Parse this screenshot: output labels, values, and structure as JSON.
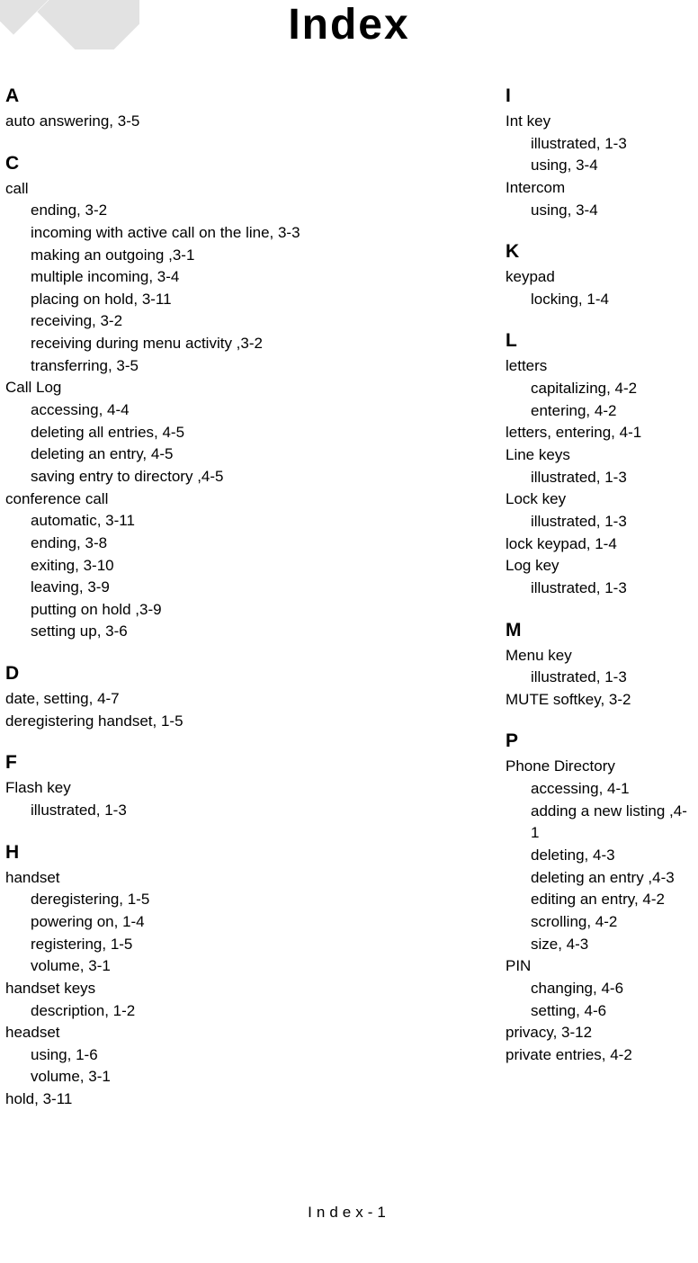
{
  "title": "Index",
  "footer": "Index-1",
  "left": [
    {
      "letter": "A",
      "first": true,
      "groups": [
        {
          "main": "auto answering, 3-5"
        }
      ]
    },
    {
      "letter": "C",
      "groups": [
        {
          "main": "call",
          "subs": [
            "ending, 3-2",
            "incoming with active call on the line, 3-3",
            "making an outgoing ,3-1",
            "multiple incoming, 3-4",
            "placing on hold, 3-11",
            "receiving, 3-2",
            "receiving during menu activity ,3-2",
            "transferring, 3-5"
          ]
        },
        {
          "main": "Call Log",
          "subs": [
            "accessing, 4-4",
            "deleting all entries, 4-5",
            "deleting an entry, 4-5",
            "saving entry to directory ,4-5"
          ]
        },
        {
          "main": "conference call",
          "subs": [
            "automatic, 3-11",
            "ending, 3-8",
            "exiting, 3-10",
            "leaving, 3-9",
            "putting on hold ,3-9",
            "setting up, 3-6"
          ]
        }
      ]
    },
    {
      "letter": "D",
      "groups": [
        {
          "main": "date, setting, 4-7"
        },
        {
          "main": "deregistering handset, 1-5"
        }
      ]
    },
    {
      "letter": "F",
      "groups": [
        {
          "main": "Flash key",
          "subs": [
            "illustrated, 1-3"
          ]
        }
      ]
    },
    {
      "letter": "H",
      "groups": [
        {
          "main": "handset",
          "subs": [
            "deregistering, 1-5",
            "powering on, 1-4",
            "registering, 1-5",
            "volume, 3-1"
          ]
        },
        {
          "main": "handset keys",
          "subs": [
            "description, 1-2"
          ]
        },
        {
          "main": "headset",
          "subs": [
            "using, 1-6",
            "volume, 3-1"
          ]
        },
        {
          "main": "hold, 3-11"
        }
      ]
    }
  ],
  "right": [
    {
      "letter": "I",
      "first": true,
      "groups": [
        {
          "main": "Int key",
          "subs": [
            "illustrated, 1-3",
            "using, 3-4"
          ]
        },
        {
          "main": "Intercom",
          "subs": [
            "using, 3-4"
          ]
        }
      ]
    },
    {
      "letter": "K",
      "groups": [
        {
          "main": "keypad",
          "subs": [
            "locking, 1-4"
          ]
        }
      ]
    },
    {
      "letter": "L",
      "groups": [
        {
          "main": "letters",
          "subs": [
            "capitalizing, 4-2",
            "entering, 4-2"
          ]
        },
        {
          "main": "letters, entering, 4-1"
        },
        {
          "main": "Line keys",
          "subs": [
            "illustrated, 1-3"
          ]
        },
        {
          "main": "Lock key",
          "subs": [
            "illustrated, 1-3"
          ]
        },
        {
          "main": "lock keypad, 1-4"
        },
        {
          "main": "Log key",
          "subs": [
            "illustrated, 1-3"
          ]
        }
      ]
    },
    {
      "letter": "M",
      "groups": [
        {
          "main": "Menu key",
          "subs": [
            "illustrated, 1-3"
          ]
        },
        {
          "main": "MUTE softkey, 3-2"
        }
      ]
    },
    {
      "letter": "P",
      "groups": [
        {
          "main": "Phone Directory",
          "subs": [
            "accessing, 4-1",
            "adding a new listing ,4-1",
            "deleting, 4-3",
            "deleting an entry ,4-3",
            "editing an entry, 4-2",
            "scrolling, 4-2",
            "size, 4-3"
          ]
        },
        {
          "main": "PIN",
          "subs": [
            "changing, 4-6",
            "setting, 4-6"
          ]
        },
        {
          "main": "privacy, 3-12"
        },
        {
          "main": "private entries, 4-2"
        }
      ]
    }
  ]
}
